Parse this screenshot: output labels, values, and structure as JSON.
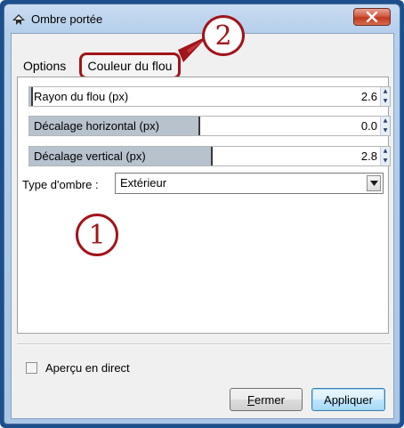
{
  "window": {
    "title": "Ombre portée"
  },
  "tabs": [
    {
      "label": "Options"
    },
    {
      "label": "Couleur du flou"
    }
  ],
  "parameters": [
    {
      "label": "Rayon du flou (px)",
      "value": "2.6"
    },
    {
      "label": "Décalage horizontal (px)",
      "value": "0.0"
    },
    {
      "label": "Décalage vertical (px)",
      "value": "2.8"
    }
  ],
  "shadow_type": {
    "label": "Type d'ombre :",
    "selected": "Extérieur"
  },
  "preview": {
    "label": "Aperçu en direct",
    "checked": false
  },
  "buttons": {
    "close": "Fermer",
    "apply": "Appliquer"
  },
  "callouts": {
    "one": "1",
    "two": "2"
  },
  "colors": {
    "frame": "#1c4f8c",
    "callout": "#a1141a",
    "close_button": "#c0391f"
  }
}
